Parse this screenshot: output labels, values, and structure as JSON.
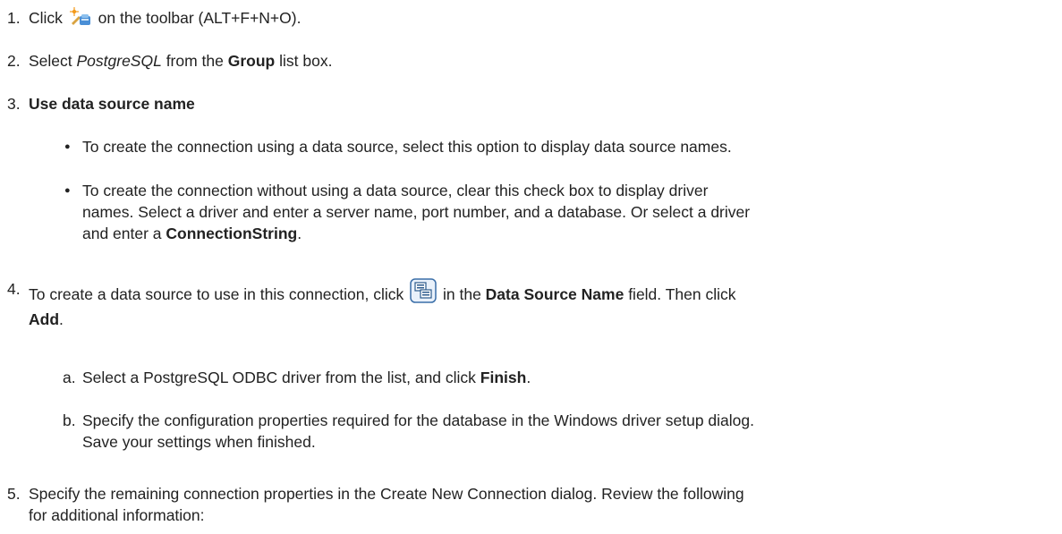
{
  "steps": [
    {
      "num": "1.",
      "a": "Click ",
      "icon": "new-connection-icon",
      "b": " on the toolbar (ALT+F+N+O)."
    },
    {
      "num": "2.",
      "a": "Select ",
      "italic": "PostgreSQL",
      "b": " from the ",
      "bold": "Group",
      "c": " list box."
    },
    {
      "num": "3.",
      "bold": "Use data source name",
      "bullets": [
        {
          "text": "To create the connection using a data source, select this option to display data source names."
        },
        {
          "a": "To create the connection without using a data source, clear this check box to display driver",
          "b": "names. Select a driver and enter a server name, port number, and a database. Or select a driver",
          "c": "and enter a ",
          "bold": "ConnectionString",
          "d": "."
        }
      ]
    },
    {
      "num": "4.",
      "a": "To create a data source to use in this connection, click ",
      "icon": "data-source-browse-icon",
      "b": " in the ",
      "bold": "Data Source Name",
      "c": " field. Then click",
      "bold2": "Add",
      "d": ".",
      "subs": [
        {
          "letter": "a.",
          "a": "Select a PostgreSQL ODBC driver from the list, and click ",
          "bold": "Finish",
          "b": "."
        },
        {
          "letter": "b.",
          "a": "Specify the configuration properties required for the database in the Windows driver setup dialog.",
          "b": "Save your settings when finished."
        }
      ]
    },
    {
      "num": "5.",
      "a": "Specify the remaining connection properties in the Create New Connection dialog. Review the following",
      "b": "for additional information:"
    }
  ],
  "bullet_glyph": "●"
}
